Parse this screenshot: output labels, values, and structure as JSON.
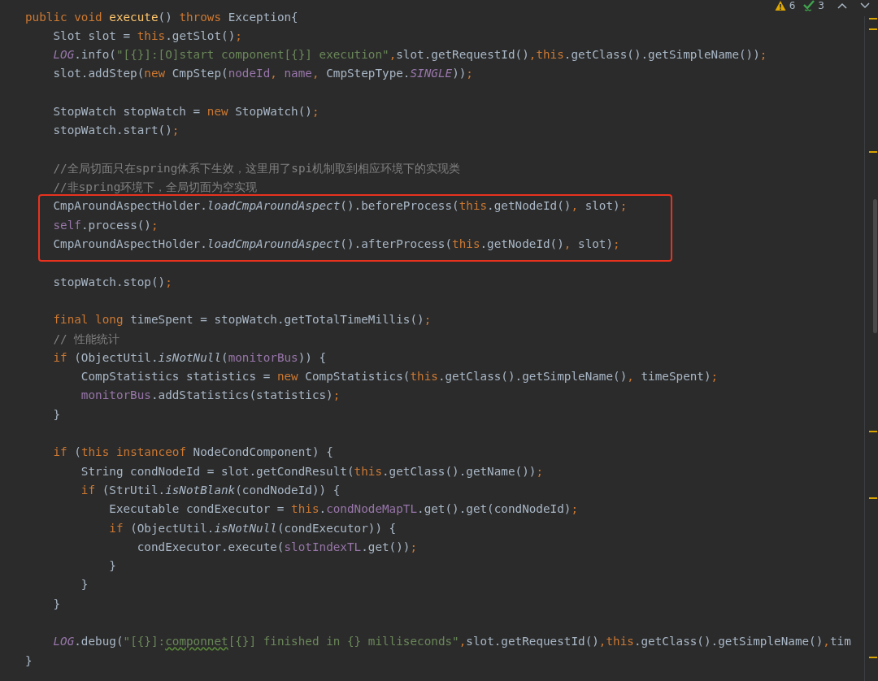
{
  "inspections": {
    "warnings": "6",
    "weak_warnings": "3"
  },
  "lines": [
    {
      "kind": "code",
      "tokens": [
        {
          "kind": "keyword",
          "text": "public void "
        },
        {
          "kind": "declaration",
          "text": "execute"
        },
        {
          "kind": "plain",
          "text": "() "
        },
        {
          "kind": "keyword",
          "text": "throws "
        },
        {
          "kind": "plain",
          "text": "Exception{"
        }
      ]
    },
    {
      "kind": "code",
      "tokens": [
        {
          "kind": "plain",
          "text": "    Slot slot = "
        },
        {
          "kind": "keyword",
          "text": "this"
        },
        {
          "kind": "plain",
          "text": ".getSlot()"
        },
        {
          "kind": "keyword",
          "text": ";"
        }
      ]
    },
    {
      "kind": "code",
      "tokens": [
        {
          "kind": "static_field",
          "text": "    LOG"
        },
        {
          "kind": "plain",
          "text": ".info("
        },
        {
          "kind": "string",
          "text": "\"[{}]:[O]start component[{}] execution\""
        },
        {
          "kind": "keyword",
          "text": ","
        },
        {
          "kind": "plain",
          "text": "slot.getRequestId()"
        },
        {
          "kind": "keyword",
          "text": ",this"
        },
        {
          "kind": "plain",
          "text": ".getClass().getSimpleName())"
        },
        {
          "kind": "keyword",
          "text": ";"
        }
      ]
    },
    {
      "kind": "code",
      "tokens": [
        {
          "kind": "plain",
          "text": "    slot.addStep("
        },
        {
          "kind": "keyword",
          "text": "new "
        },
        {
          "kind": "plain",
          "text": "CmpStep("
        },
        {
          "kind": "field",
          "text": "nodeId"
        },
        {
          "kind": "keyword",
          "text": ", "
        },
        {
          "kind": "field",
          "text": "name"
        },
        {
          "kind": "keyword",
          "text": ", "
        },
        {
          "kind": "plain",
          "text": "CmpStepType."
        },
        {
          "kind": "static_field",
          "text": "SINGLE"
        },
        {
          "kind": "plain",
          "text": "))"
        },
        {
          "kind": "keyword",
          "text": ";"
        }
      ]
    },
    {
      "kind": "blank"
    },
    {
      "kind": "code",
      "tokens": [
        {
          "kind": "plain",
          "text": "    StopWatch stopWatch = "
        },
        {
          "kind": "keyword",
          "text": "new "
        },
        {
          "kind": "plain",
          "text": "StopWatch()"
        },
        {
          "kind": "keyword",
          "text": ";"
        }
      ]
    },
    {
      "kind": "code",
      "tokens": [
        {
          "kind": "plain",
          "text": "    stopWatch.start()"
        },
        {
          "kind": "keyword",
          "text": ";"
        }
      ]
    },
    {
      "kind": "blank"
    },
    {
      "kind": "code",
      "tokens": [
        {
          "kind": "comment",
          "text": "    //全局切面只在spring体系下生效，这里用了spi机制取到相应环境下的实现类"
        }
      ]
    },
    {
      "kind": "code",
      "tokens": [
        {
          "kind": "comment",
          "text": "    //非spring环境下，全局切面为空实现"
        }
      ]
    },
    {
      "kind": "framed",
      "lines": [
        {
          "kind": "code",
          "tokens": [
            {
              "kind": "plain",
              "text": "    CmpAroundAspectHolder."
            },
            {
              "kind": "static_method",
              "text": "loadCmpAroundAspect"
            },
            {
              "kind": "plain",
              "text": "().beforeProcess("
            },
            {
              "kind": "keyword",
              "text": "this"
            },
            {
              "kind": "plain",
              "text": ".getNodeId()"
            },
            {
              "kind": "keyword",
              "text": ", "
            },
            {
              "kind": "plain",
              "text": "slot)"
            },
            {
              "kind": "keyword",
              "text": ";"
            }
          ]
        },
        {
          "kind": "code",
          "tokens": [
            {
              "kind": "field",
              "text": "    self"
            },
            {
              "kind": "plain",
              "text": ".process()"
            },
            {
              "kind": "keyword",
              "text": ";"
            }
          ]
        },
        {
          "kind": "code",
          "tokens": [
            {
              "kind": "plain",
              "text": "    CmpAroundAspectHolder."
            },
            {
              "kind": "static_method",
              "text": "loadCmpAroundAspect"
            },
            {
              "kind": "plain",
              "text": "().afterProcess("
            },
            {
              "kind": "keyword",
              "text": "this"
            },
            {
              "kind": "plain",
              "text": ".getNodeId()"
            },
            {
              "kind": "keyword",
              "text": ", "
            },
            {
              "kind": "plain",
              "text": "slot)"
            },
            {
              "kind": "keyword",
              "text": ";"
            }
          ]
        }
      ]
    },
    {
      "kind": "blank"
    },
    {
      "kind": "code",
      "tokens": [
        {
          "kind": "plain",
          "text": "    stopWatch.stop()"
        },
        {
          "kind": "keyword",
          "text": ";"
        }
      ]
    },
    {
      "kind": "blank"
    },
    {
      "kind": "code",
      "tokens": [
        {
          "kind": "keyword",
          "text": "    final long "
        },
        {
          "kind": "plain",
          "text": "timeSpent = stopWatch.getTotalTimeMillis()"
        },
        {
          "kind": "keyword",
          "text": ";"
        }
      ]
    },
    {
      "kind": "code",
      "tokens": [
        {
          "kind": "comment",
          "text": "    // 性能统计"
        }
      ]
    },
    {
      "kind": "code",
      "tokens": [
        {
          "kind": "keyword",
          "text": "    if "
        },
        {
          "kind": "plain",
          "text": "(ObjectUtil."
        },
        {
          "kind": "static_method",
          "text": "isNotNull"
        },
        {
          "kind": "plain",
          "text": "("
        },
        {
          "kind": "field",
          "text": "monitorBus"
        },
        {
          "kind": "plain",
          "text": ")) {"
        }
      ]
    },
    {
      "kind": "code",
      "tokens": [
        {
          "kind": "plain",
          "text": "        CompStatistics statistics = "
        },
        {
          "kind": "keyword",
          "text": "new "
        },
        {
          "kind": "plain",
          "text": "CompStatistics("
        },
        {
          "kind": "keyword",
          "text": "this"
        },
        {
          "kind": "plain",
          "text": ".getClass().getSimpleName()"
        },
        {
          "kind": "keyword",
          "text": ", "
        },
        {
          "kind": "plain",
          "text": "timeSpent)"
        },
        {
          "kind": "keyword",
          "text": ";"
        }
      ]
    },
    {
      "kind": "code",
      "tokens": [
        {
          "kind": "field",
          "text": "        monitorBus"
        },
        {
          "kind": "plain",
          "text": ".addStatistics(statistics)"
        },
        {
          "kind": "keyword",
          "text": ";"
        }
      ]
    },
    {
      "kind": "code",
      "tokens": [
        {
          "kind": "plain",
          "text": "    }"
        }
      ]
    },
    {
      "kind": "blank"
    },
    {
      "kind": "code",
      "tokens": [
        {
          "kind": "keyword",
          "text": "    if "
        },
        {
          "kind": "plain",
          "text": "("
        },
        {
          "kind": "keyword",
          "text": "this instanceof "
        },
        {
          "kind": "plain",
          "text": "NodeCondComponent) {"
        }
      ]
    },
    {
      "kind": "code",
      "tokens": [
        {
          "kind": "plain",
          "text": "        String condNodeId = slot.getCondResult("
        },
        {
          "kind": "keyword",
          "text": "this"
        },
        {
          "kind": "plain",
          "text": ".getClass().getName())"
        },
        {
          "kind": "keyword",
          "text": ";"
        }
      ]
    },
    {
      "kind": "code",
      "tokens": [
        {
          "kind": "keyword",
          "text": "        if "
        },
        {
          "kind": "plain",
          "text": "(StrUtil."
        },
        {
          "kind": "static_method",
          "text": "isNotBlank"
        },
        {
          "kind": "plain",
          "text": "(condNodeId)) {"
        }
      ]
    },
    {
      "kind": "code",
      "tokens": [
        {
          "kind": "plain",
          "text": "            Executable condExecutor = "
        },
        {
          "kind": "keyword",
          "text": "this"
        },
        {
          "kind": "plain",
          "text": "."
        },
        {
          "kind": "field",
          "text": "condNodeMapTL"
        },
        {
          "kind": "plain",
          "text": ".get().get(condNodeId)"
        },
        {
          "kind": "keyword",
          "text": ";"
        }
      ]
    },
    {
      "kind": "code",
      "tokens": [
        {
          "kind": "keyword",
          "text": "            if "
        },
        {
          "kind": "plain",
          "text": "(ObjectUtil."
        },
        {
          "kind": "static_method",
          "text": "isNotNull"
        },
        {
          "kind": "plain",
          "text": "(condExecutor)) {"
        }
      ]
    },
    {
      "kind": "code",
      "tokens": [
        {
          "kind": "plain",
          "text": "                condExecutor.execute("
        },
        {
          "kind": "field",
          "text": "slotIndexTL"
        },
        {
          "kind": "plain",
          "text": ".get())"
        },
        {
          "kind": "keyword",
          "text": ";"
        }
      ]
    },
    {
      "kind": "code",
      "tokens": [
        {
          "kind": "plain",
          "text": "            }"
        }
      ]
    },
    {
      "kind": "code",
      "tokens": [
        {
          "kind": "plain",
          "text": "        }"
        }
      ]
    },
    {
      "kind": "code",
      "tokens": [
        {
          "kind": "plain",
          "text": "    }"
        }
      ]
    },
    {
      "kind": "blank"
    },
    {
      "kind": "code",
      "tokens": [
        {
          "kind": "static_field",
          "text": "    LOG"
        },
        {
          "kind": "plain",
          "text": ".debug("
        },
        {
          "kind": "string",
          "text": "\"[{}]:"
        },
        {
          "kind": "string",
          "text": "componnet",
          "typo": true
        },
        {
          "kind": "string",
          "text": "[{}] finished in {} milliseconds\""
        },
        {
          "kind": "keyword",
          "text": ","
        },
        {
          "kind": "plain",
          "text": "slot.getRequestId()"
        },
        {
          "kind": "keyword",
          "text": ",this"
        },
        {
          "kind": "plain",
          "text": ".getClass().getSimpleName()"
        },
        {
          "kind": "keyword",
          "text": ","
        },
        {
          "kind": "plain",
          "text": "tim"
        }
      ]
    },
    {
      "kind": "code",
      "tokens": [
        {
          "kind": "plain",
          "text": "}"
        }
      ]
    }
  ]
}
